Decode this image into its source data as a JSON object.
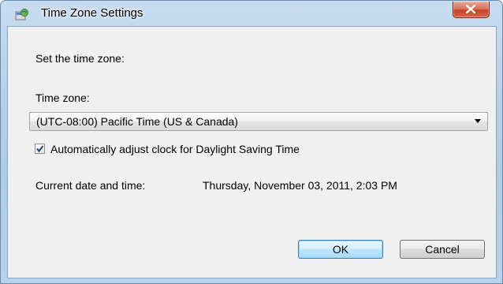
{
  "window": {
    "title": "Time Zone Settings",
    "title_icon": "clock-globe-icon",
    "close_icon": "close-icon"
  },
  "dialog": {
    "instruction": "Set the time zone:",
    "timezone_label": "Time zone:",
    "timezone_selected": "(UTC-08:00) Pacific Time (US & Canada)",
    "dst_checkbox_label": "Automatically adjust clock for Daylight Saving Time",
    "dst_checked": true,
    "current_datetime_label": "Current date and time:",
    "current_datetime_value": "Thursday, November 03, 2011, 2:03 PM"
  },
  "buttons": {
    "ok_label": "OK",
    "cancel_label": "Cancel"
  },
  "colors": {
    "close_button": "#c7432a",
    "default_button_border": "#3c7fb1",
    "client_background": "#f0f0f0"
  }
}
